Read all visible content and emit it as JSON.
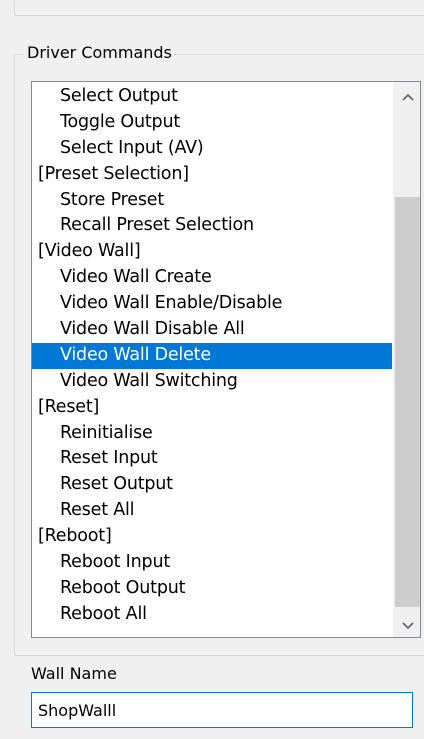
{
  "group": {
    "title": "Driver Commands"
  },
  "list": {
    "items": [
      {
        "label": "Select Output",
        "indent": true,
        "selected": false
      },
      {
        "label": "Toggle Output",
        "indent": true,
        "selected": false
      },
      {
        "label": "Select Input (AV)",
        "indent": true,
        "selected": false
      },
      {
        "label": "[Preset Selection]",
        "indent": false,
        "selected": false
      },
      {
        "label": "Store Preset",
        "indent": true,
        "selected": false
      },
      {
        "label": "Recall Preset Selection",
        "indent": true,
        "selected": false
      },
      {
        "label": "[Video Wall]",
        "indent": false,
        "selected": false
      },
      {
        "label": "Video Wall Create",
        "indent": true,
        "selected": false
      },
      {
        "label": "Video Wall Enable/Disable",
        "indent": true,
        "selected": false
      },
      {
        "label": "Video Wall Disable All",
        "indent": true,
        "selected": false
      },
      {
        "label": "Video Wall Delete",
        "indent": true,
        "selected": true
      },
      {
        "label": "Video Wall Switching",
        "indent": true,
        "selected": false
      },
      {
        "label": "[Reset]",
        "indent": false,
        "selected": false
      },
      {
        "label": "Reinitialise",
        "indent": true,
        "selected": false
      },
      {
        "label": "Reset Input",
        "indent": true,
        "selected": false
      },
      {
        "label": "Reset Output",
        "indent": true,
        "selected": false
      },
      {
        "label": "Reset All",
        "indent": true,
        "selected": false
      },
      {
        "label": "[Reboot]",
        "indent": false,
        "selected": false
      },
      {
        "label": "Reboot Input",
        "indent": true,
        "selected": false
      },
      {
        "label": "Reboot Output",
        "indent": true,
        "selected": false
      },
      {
        "label": "Reboot All",
        "indent": true,
        "selected": false
      }
    ],
    "scroll_up_icon": "chevron-up-icon",
    "scroll_down_icon": "chevron-down-icon"
  },
  "wall_name": {
    "label": "Wall Name",
    "value": "ShopWalll"
  },
  "colors": {
    "selection": "#0078d7",
    "focus_border": "#0078d7",
    "scroll_thumb": "#cdcdcd"
  }
}
